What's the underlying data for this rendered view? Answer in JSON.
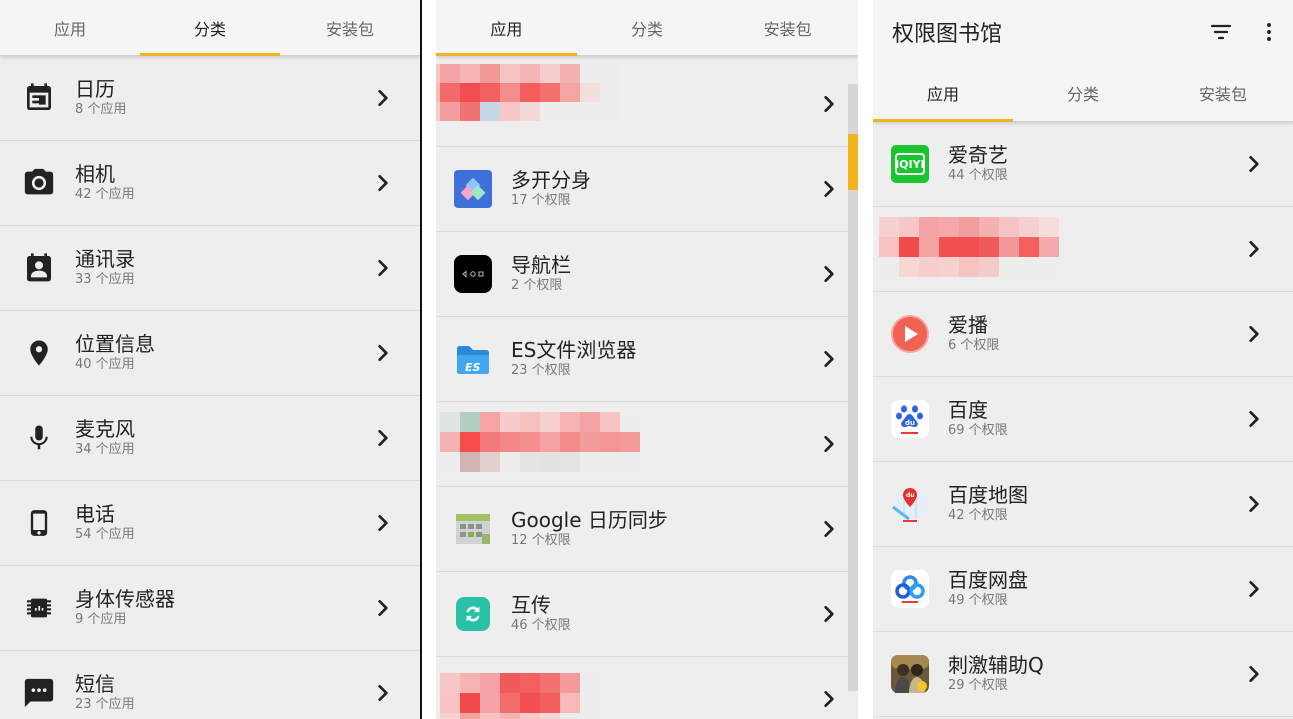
{
  "panel1": {
    "tabs": [
      "应用",
      "分类",
      "安装包"
    ],
    "active_tab": 1,
    "items": [
      {
        "name": "日历",
        "sub": "8 个应用",
        "icon": "calendar-icon"
      },
      {
        "name": "相机",
        "sub": "42 个应用",
        "icon": "camera-icon"
      },
      {
        "name": "通讯录",
        "sub": "33 个应用",
        "icon": "contacts-icon"
      },
      {
        "name": "位置信息",
        "sub": "40 个应用",
        "icon": "location-icon"
      },
      {
        "name": "麦克风",
        "sub": "34 个应用",
        "icon": "microphone-icon"
      },
      {
        "name": "电话",
        "sub": "54 个应用",
        "icon": "phone-icon"
      },
      {
        "name": "身体传感器",
        "sub": "9 个应用",
        "icon": "sensor-chip-icon"
      },
      {
        "name": "短信",
        "sub": "23 个应用",
        "icon": "sms-icon"
      }
    ]
  },
  "panel2": {
    "tabs": [
      "应用",
      "分类",
      "安装包"
    ],
    "active_tab": 0,
    "items": [
      {
        "name": "",
        "sub": "",
        "icon": "blurred-app-icon",
        "redacted": true
      },
      {
        "name": "多开分身",
        "sub": "17 个权限",
        "icon": "multi-instance-app-icon"
      },
      {
        "name": "导航栏",
        "sub": "2 个权限",
        "icon": "navigation-bar-app-icon"
      },
      {
        "name": "ES文件浏览器",
        "sub": "23 个权限",
        "icon": "es-file-explorer-icon"
      },
      {
        "name": "",
        "sub": "",
        "icon": "blurred-app-icon",
        "redacted": true
      },
      {
        "name": "Google 日历同步",
        "sub": "12 个权限",
        "icon": "google-calendar-sync-icon"
      },
      {
        "name": "互传",
        "sub": "46 个权限",
        "icon": "transfer-app-icon"
      },
      {
        "name": "",
        "sub": "",
        "icon": "blurred-app-icon",
        "redacted": true
      }
    ]
  },
  "panel3": {
    "title": "权限图书馆",
    "tabs": [
      "应用",
      "分类",
      "安装包"
    ],
    "active_tab": 0,
    "items": [
      {
        "name": "爱奇艺",
        "sub": "44 个权限",
        "icon": "iqiyi-icon"
      },
      {
        "name": "",
        "sub": "",
        "icon": "blurred-app-icon",
        "redacted": true
      },
      {
        "name": "爱播",
        "sub": "6 个权限",
        "icon": "aibo-play-icon"
      },
      {
        "name": "百度",
        "sub": "69 个权限",
        "icon": "baidu-paw-icon"
      },
      {
        "name": "百度地图",
        "sub": "42 个权限",
        "icon": "baidu-map-icon"
      },
      {
        "name": "百度网盘",
        "sub": "49 个权限",
        "icon": "baidu-netdisk-icon"
      },
      {
        "name": "刺激辅助Q",
        "sub": "29 个权限",
        "icon": "game-helper-icon"
      }
    ]
  },
  "colors": {
    "accent": "#f2b41e",
    "background": "#eeeeee",
    "tabbar": "#f5f5f5",
    "mosaic_red": "#f05a5a"
  }
}
